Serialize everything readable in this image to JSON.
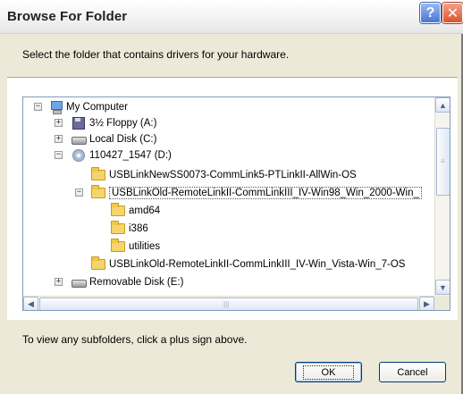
{
  "window": {
    "title": "Browse For Folder",
    "help_label": "?",
    "close_label": "✕"
  },
  "instruction": "Select the folder that contains drivers for your hardware.",
  "tree": {
    "items": [
      {
        "label": "My Computer",
        "icon": "computer-icon",
        "expander": "−"
      },
      {
        "label": "3½ Floppy (A:)",
        "icon": "floppy-icon",
        "expander": "+"
      },
      {
        "label": "Local Disk (C:)",
        "icon": "disk-icon",
        "expander": "+"
      },
      {
        "label": "110427_1547 (D:)",
        "icon": "cd-icon",
        "expander": "−"
      },
      {
        "label": "USBLinkNewSS0073-CommLink5-PTLinkII-AllWin-OS",
        "icon": "folder-icon",
        "expander": ""
      },
      {
        "label": "USBLinkOld-RemoteLinkII-CommLinkIII_IV-Win98_Win_2000-Win_",
        "icon": "folder-icon",
        "expander": "−"
      },
      {
        "label": "amd64",
        "icon": "folder-icon",
        "expander": ""
      },
      {
        "label": "i386",
        "icon": "folder-icon",
        "expander": ""
      },
      {
        "label": "utilities",
        "icon": "folder-icon",
        "expander": ""
      },
      {
        "label": "USBLinkOld-RemoteLinkII-CommLinkIII_IV-Win_Vista-Win_7-OS",
        "icon": "folder-icon",
        "expander": ""
      },
      {
        "label": "Removable Disk (E:)",
        "icon": "disk-icon",
        "expander": "+"
      }
    ]
  },
  "scrollbars": {
    "up": "▲",
    "down": "▼",
    "left": "◀",
    "right": "▶",
    "grip_v": "≡",
    "grip_h": "|||"
  },
  "hint": "To view any subfolders, click a plus sign above.",
  "buttons": {
    "ok": "OK",
    "cancel": "Cancel"
  }
}
